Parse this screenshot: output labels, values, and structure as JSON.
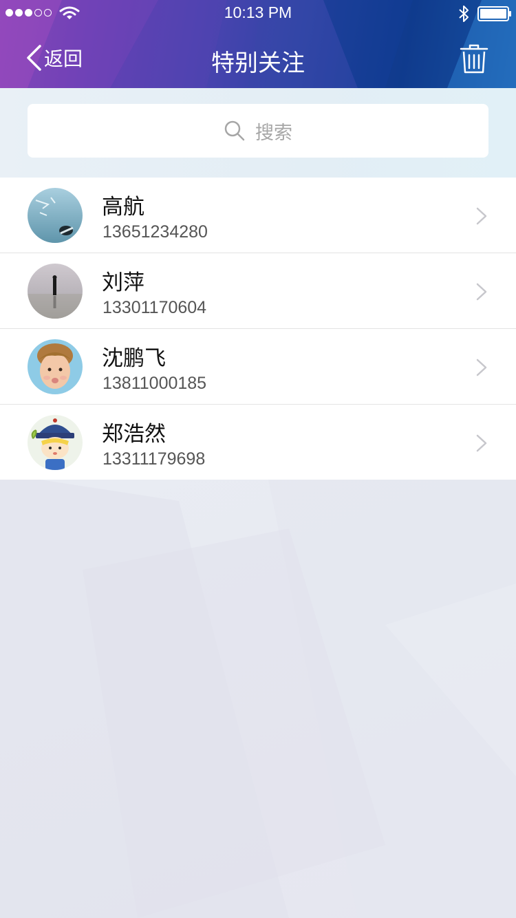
{
  "status_bar": {
    "time": "10:13 PM",
    "signal_strength": 3,
    "signal_max": 5,
    "icons": [
      "wifi-icon",
      "bluetooth-icon",
      "battery-icon"
    ]
  },
  "nav": {
    "back_label": "返回",
    "title": "特别关注",
    "back_icon": "chevron-left-icon",
    "action_icon": "trash-icon"
  },
  "search": {
    "placeholder": "搜索",
    "icon": "search-icon"
  },
  "contacts": [
    {
      "name": "高航",
      "phone": "13651234280"
    },
    {
      "name": "刘萍",
      "phone": "13301170604"
    },
    {
      "name": "沈鹏飞",
      "phone": "13811000185"
    },
    {
      "name": "郑浩然",
      "phone": "13311179698"
    }
  ],
  "colors": {
    "header_gradient_start": "#8a45b8",
    "header_gradient_end": "#1d62b5",
    "separator": "#e3e3e3",
    "placeholder_text": "#a6a6a6",
    "chevron": "#c7c7cc"
  }
}
